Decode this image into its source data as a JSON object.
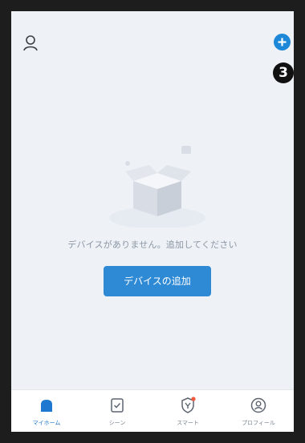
{
  "header": {
    "profile_icon": "person-outline-icon",
    "add_icon": "plus-circle-icon",
    "step_badge": "3",
    "accent": "#1e88d8"
  },
  "empty_state": {
    "illustration": "empty-box-icon",
    "message": "デバイスがありません。追加してください",
    "button_label": "デバイスの追加",
    "button_color": "#2f8ad6"
  },
  "tabs": [
    {
      "label": "マイホーム",
      "icon": "home-icon",
      "active": true
    },
    {
      "label": "シーン",
      "icon": "scene-checkbox-icon",
      "active": false
    },
    {
      "label": "スマート",
      "icon": "smart-shield-icon",
      "active": false
    },
    {
      "label": "プロフィール",
      "icon": "profile-circle-icon",
      "active": false
    }
  ]
}
